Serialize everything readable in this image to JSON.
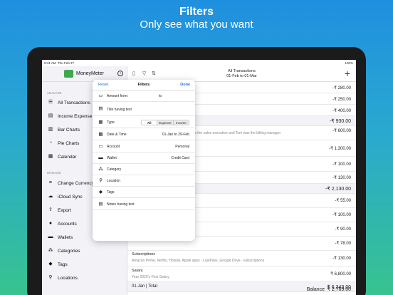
{
  "hero": {
    "title": "Filters",
    "subtitle": "Only see what you want"
  },
  "status": {
    "time": "9:41 AM",
    "date": "Thu Feb 27",
    "battery": "100%"
  },
  "sidebar": {
    "app_name": "MoneyMeter",
    "analyse_label": "ANALYSE",
    "manage_label": "MANAGE",
    "analyse_items": [
      {
        "label": "All Transactions",
        "icon": "list-icon"
      },
      {
        "label": "Income Expense",
        "icon": "income-expense-icon"
      },
      {
        "label": "Bar Charts",
        "icon": "bar-chart-icon"
      },
      {
        "label": "Pie Charts",
        "icon": "pie-chart-icon"
      },
      {
        "label": "Calendar",
        "icon": "calendar-icon"
      }
    ],
    "manage_items": [
      {
        "label": "Change Currency",
        "icon": "currency-icon"
      },
      {
        "label": "iCloud Sync",
        "icon": "cloud-icon"
      },
      {
        "label": "Export",
        "icon": "export-icon"
      },
      {
        "label": "Accounts",
        "icon": "accounts-icon"
      },
      {
        "label": "Wallets",
        "icon": "wallet-icon"
      },
      {
        "label": "Categories",
        "icon": "categories-icon"
      },
      {
        "label": "Tags",
        "icon": "tag-icon"
      },
      {
        "label": "Locations",
        "icon": "location-icon"
      }
    ]
  },
  "toolbar": {
    "title": "All Transactions",
    "range": "01-Feb to 01-Mar"
  },
  "transactions": {
    "rows": [
      {
        "label": "",
        "desc": "",
        "amount": "-₹ 280.00"
      },
      {
        "label": "",
        "desc": "",
        "amount": "-₹ 250.00"
      },
      {
        "label": "",
        "desc": "",
        "amount": "-₹ 400.00"
      },
      {
        "label": "",
        "desc": "",
        "amount": "-₹ 930.00",
        "group": true
      },
      {
        "label": "",
        "desc": "City Mall. Eric was the sales executive and Tom was the billing manager",
        "amount": "-₹ 600.00"
      },
      {
        "label": "",
        "desc": "",
        "amount": "-₹ 1,300.00"
      },
      {
        "label": "",
        "desc": "",
        "amount": "-₹ 100.00"
      },
      {
        "label": "",
        "desc": "",
        "amount": "-₹ 130.00"
      },
      {
        "label": "",
        "desc": "",
        "amount": "-₹ 2,130.00",
        "group": true
      },
      {
        "label": "",
        "desc": "",
        "amount": "-₹ 55.00"
      },
      {
        "label": "",
        "desc": "",
        "amount": "-₹ 100.00"
      },
      {
        "label": "",
        "desc": "",
        "amount": "-₹ 90.00"
      },
      {
        "label": "",
        "desc": "",
        "amount": "-₹ 78.00"
      },
      {
        "label": "Subscriptions",
        "desc": "Amazon Prime, Netflix, Hotstar, Apple apps - LastPass, Google Drive - subscriptions",
        "amount": "-₹ 130.00"
      },
      {
        "label": "Salary",
        "desc": "Year 2020's First Salary",
        "amount": "₹ 6,800.00"
      },
      {
        "label": "01-Jan | Total",
        "desc": "",
        "amount": "₹ 6,343.00",
        "group": true
      }
    ],
    "balance_label": "Balance",
    "balance_value": "₹ 2,769.00"
  },
  "filters": {
    "reset": "Reset",
    "title": "Filters",
    "done": "Done",
    "amount_from": "Amount from:",
    "amount_to": "to",
    "title_text": "Title having text",
    "type_label": "Type",
    "type_options": [
      "All",
      "Expense",
      "Income"
    ],
    "type_selected": "All",
    "datetime_label": "Date & Time",
    "datetime_value": "01-Jan to 29-Feb",
    "account_label": "Account",
    "account_value": "Personal",
    "wallet_label": "Wallet",
    "wallet_value": "Credit Card",
    "category_label": "Category",
    "location_label": "Location",
    "tags_label": "Tags",
    "notes_label": "Notes having text"
  }
}
